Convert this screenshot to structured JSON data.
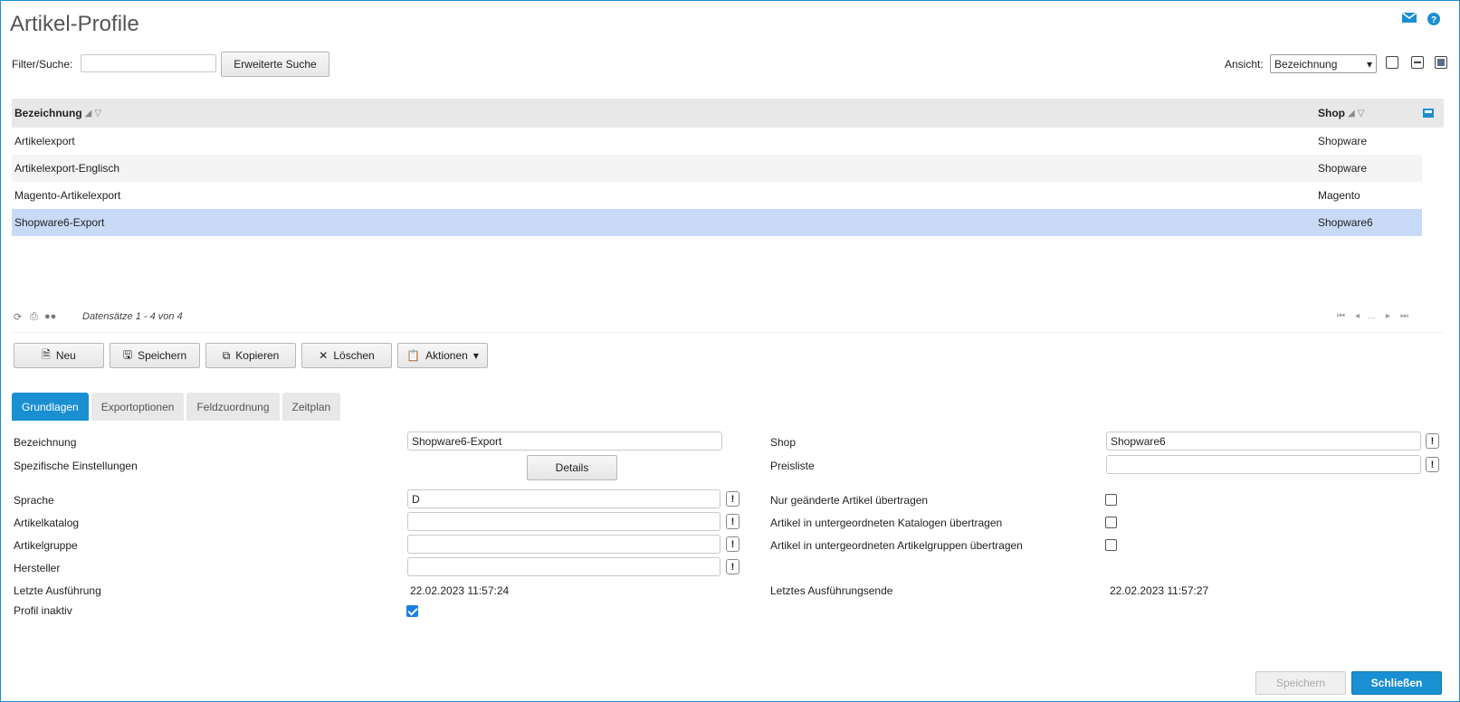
{
  "window": {
    "title": "Artikel-Profile"
  },
  "header_icons": {
    "mail": "mail-icon",
    "help": "help-icon"
  },
  "filter": {
    "label": "Filter/Suche:",
    "value": "",
    "advanced_button": "Erweiterte Suche"
  },
  "view": {
    "label": "Ansicht:",
    "selected": "Bezeichnung"
  },
  "grid": {
    "columns": [
      "Bezeichnung",
      "Shop"
    ],
    "rows": [
      {
        "name": "Artikelexport",
        "shop": "Shopware"
      },
      {
        "name": "Artikelexport-Englisch",
        "shop": "Shopware"
      },
      {
        "name": "Magento-Artikelexport",
        "shop": "Magento"
      },
      {
        "name": "Shopware6-Export",
        "shop": "Shopware6"
      }
    ],
    "selected_row": 3
  },
  "pager": {
    "count_text": "Datensätze 1 - 4 von 4",
    "ellipsis": "..."
  },
  "actions": {
    "new": "Neu",
    "save": "Speichern",
    "copy": "Kopieren",
    "delete": "Löschen",
    "more": "Aktionen"
  },
  "tabs": [
    "Grundlagen",
    "Exportoptionen",
    "Feldzuordnung",
    "Zeitplan"
  ],
  "form": {
    "bezeichnung": {
      "label": "Bezeichnung",
      "value": "Shopware6-Export"
    },
    "spezifisch": {
      "label": "Spezifische Einstellungen",
      "button": "Details"
    },
    "sprache": {
      "label": "Sprache",
      "value": "D"
    },
    "artikelkatalog": {
      "label": "Artikelkatalog",
      "value": ""
    },
    "artikelgruppe": {
      "label": "Artikelgruppe",
      "value": ""
    },
    "hersteller": {
      "label": "Hersteller",
      "value": ""
    },
    "letzte_ausfuehrung": {
      "label": "Letzte Ausführung",
      "value": "22.02.2023 11:57:24"
    },
    "profil_inaktiv": {
      "label": "Profil inaktiv",
      "checked": true
    },
    "shop": {
      "label": "Shop",
      "value": "Shopware6"
    },
    "preisliste": {
      "label": "Preisliste",
      "value": ""
    },
    "nur_geaenderte": {
      "label": "Nur geänderte Artikel übertragen",
      "checked": false
    },
    "unter_kataloge": {
      "label": "Artikel in untergeordneten Katalogen übertragen",
      "checked": false
    },
    "unter_gruppen": {
      "label": "Artikel in untergeordneten Artikelgruppen übertragen",
      "checked": false
    },
    "letztes_ende": {
      "label": "Letztes Ausführungsende",
      "value": "22.02.2023 11:57:27"
    },
    "bang": "!"
  },
  "footer": {
    "save": "Speichern",
    "close": "Schließen"
  }
}
